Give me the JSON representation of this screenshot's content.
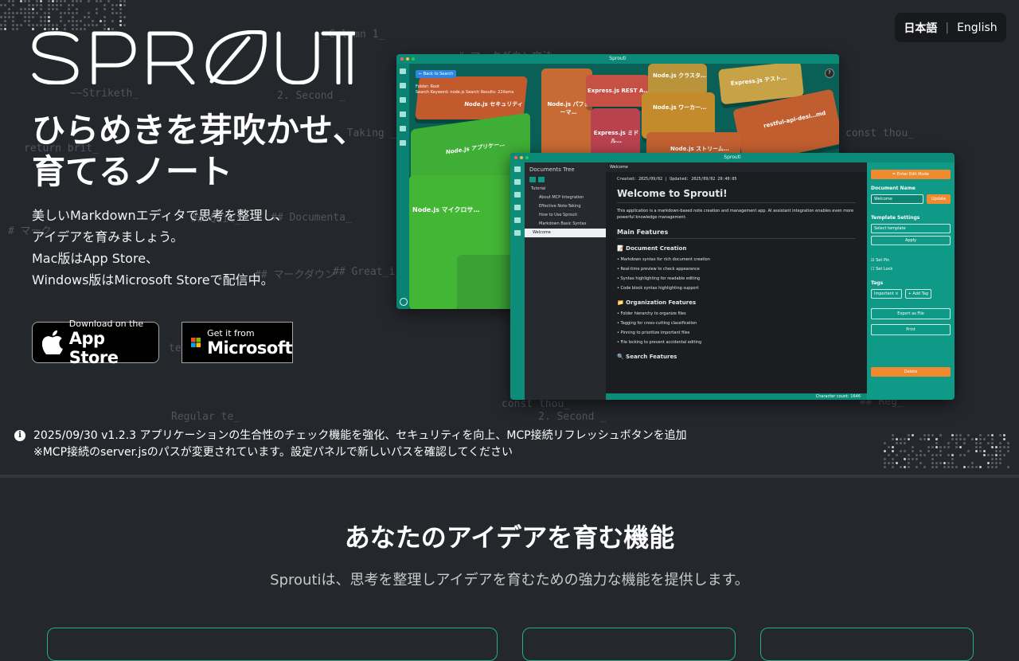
{
  "language_switch": {
    "japanese": "日本語",
    "separator": "|",
    "english": "English"
  },
  "hero": {
    "logo": "SPROUTI",
    "tagline": [
      "ひらめきを芽吹かせ、",
      "育てるノート"
    ],
    "description": [
      "美しいMarkdownエディタで思考を整理し、",
      "アイデアを育みましょう。",
      "Mac版はApp Store、",
      "Windows版はMicrosoft Storeで配信中。"
    ],
    "app_store": {
      "small": "Download on the",
      "big": "App Store"
    },
    "microsoft": {
      "small": "Get it from",
      "big": "Microsoft"
    }
  },
  "background_code": [
    "_Column 1_",
    "# マークダウン文法",
    "~~Striketh_",
    "2. Second _",
    "- Taking _",
    "const thou_",
    "return brit_",
    "# マーク",
    "## Quic_",
    "## Documenta_",
    "## マークダウン",
    "## Great_i_",
    "te_",
    "Regular te_",
    "const thou_",
    "2. Second _",
    "## Reg_"
  ],
  "screenshot_map": {
    "app_title": "Sprouti",
    "back_button": "← Back to Search",
    "folder_label": "Folder: Root",
    "search_label": "Search Keyword: node.js  Search Results: 22items",
    "help": "?",
    "blocks": [
      {
        "label": "Node.js セキュリティ",
        "color": "#c25a2e"
      },
      {
        "label": "Node.js パフォーマ…",
        "color": "#c86a34"
      },
      {
        "label": "Express.js REST A…",
        "color": "#c65043"
      },
      {
        "label": "Node.js クラスタ…",
        "color": "#b9943a"
      },
      {
        "label": "Express.js テスト…",
        "color": "#c8a247"
      },
      {
        "label": "Node.js アプリケー…",
        "color": "#3fae36"
      },
      {
        "label": "Express.js ミドル…",
        "color": "#b9424f"
      },
      {
        "label": "Node.js ワーカー…",
        "color": "#c38b2c"
      },
      {
        "label": "restful-api-desi…md",
        "color": "#c15e2f"
      },
      {
        "label": "Node.js ストリーム…",
        "color": "#c26132"
      },
      {
        "label": "Node.js マイクロサ…",
        "color": "#43b636"
      }
    ]
  },
  "screenshot_editor": {
    "app_title": "Sprouti",
    "tree_title": "Documents Tree",
    "tree_items": [
      "Tutorial",
      "About MCP Integration",
      "Effective Note-Taking",
      "How to Use Sprouti",
      "Markdown Basic Syntax",
      "Welcome"
    ],
    "tab": "Welcome",
    "meta": "Created: 2025/09/02  |  Updated: 2025/09/02 20:40:05",
    "doc_title": "Welcome to Sprouti!",
    "intro": "This application is a markdown-based note creation and management app. AI assistant integration enables even more powerful knowledge management.",
    "main_features": "Main Features",
    "doc_creation": "📝 Document Creation",
    "doc_items": [
      "Markdown syntax for rich document creation",
      "Real-time preview to check appearance",
      "Syntax highlighting for readable editing",
      "Code block syntax highlighting support"
    ],
    "org_features": "📁 Organization Features",
    "org_items": [
      "Folder hierarchy to organize files",
      "Tagging for cross-cutting classification",
      "Pinning to prioritize important files",
      "File locking to prevent accidental editing"
    ],
    "search_features": "🔍 Search Features",
    "char_count": "Character count: 1646",
    "right": {
      "edit_mode": "✏ Enter Edit Mode",
      "doc_name_label": "Document Name",
      "doc_name_value": "Welcome",
      "update": "Update",
      "template_label": "Template Settings",
      "template_select": "Select template",
      "apply": "Apply",
      "set_pin": "Set Pin",
      "set_lock": "Set Lock",
      "tags_label": "Tags",
      "tag_important": "Important ×",
      "add_tag": "+ Add Tag",
      "export": "Export as File",
      "print": "Print",
      "delete": "Delete"
    }
  },
  "notice": {
    "icon": "i",
    "line1": "2025/09/30 v1.2.3 アプリケーションの生合性のチェック機能を強化、セキュリティを向上、MCP接続リフレッシュボタンを追加",
    "line2": "※MCP接続のserver.jsのパスが変更されています。設定パネルで新しいパスを確認してください"
  },
  "features": {
    "title": "あなたのアイデアを育む機能",
    "subtitle": "Sproutiは、思考を整理しアイデアを育むための強力な機能を提供します。"
  }
}
